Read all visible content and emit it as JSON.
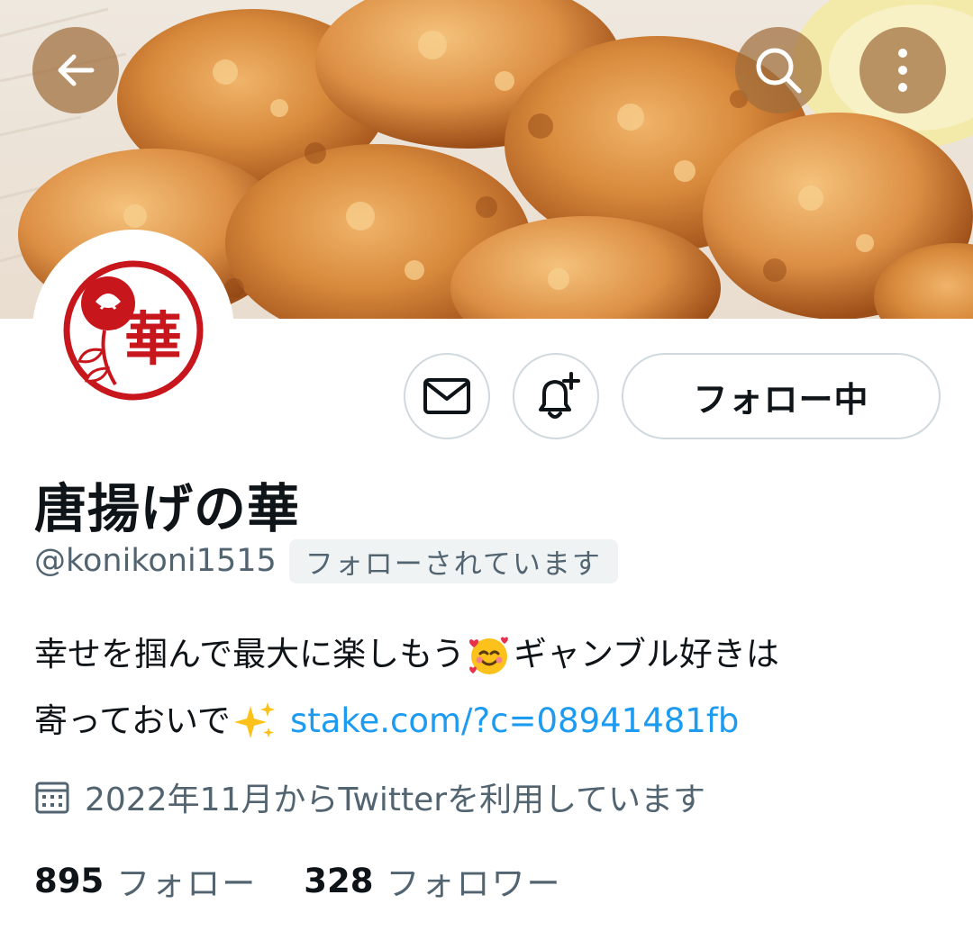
{
  "header": {
    "back_icon": "back-arrow-icon",
    "search_icon": "search-icon",
    "more_icon": "more-vertical-icon"
  },
  "banner": {
    "subject": "karaage fried chicken"
  },
  "avatar": {
    "logo_char": "華",
    "accent_color": "#c8161d"
  },
  "actions": {
    "message_icon": "mail-icon",
    "notify_icon": "bell-plus-icon",
    "follow_label": "フォロー中"
  },
  "profile": {
    "display_name": "唐揚げの華",
    "handle": "@konikoni1515",
    "follows_you": "フォローされています",
    "bio_line1_a": "幸せを掴んで最大に楽しもう",
    "bio_line1_b": "ギャンブル好きは",
    "bio_line2_a": "寄っておいで",
    "bio_link": "stake.com/?c=08941481fb",
    "joined": "2022年11月からTwitterを利用しています"
  },
  "stats": {
    "following_count": "895",
    "following_label": "フォロー",
    "followers_count": "328",
    "followers_label": "フォロワー"
  },
  "colors": {
    "link": "#1d9bf0",
    "secondary_text": "#536471",
    "border": "#cfd9de"
  }
}
